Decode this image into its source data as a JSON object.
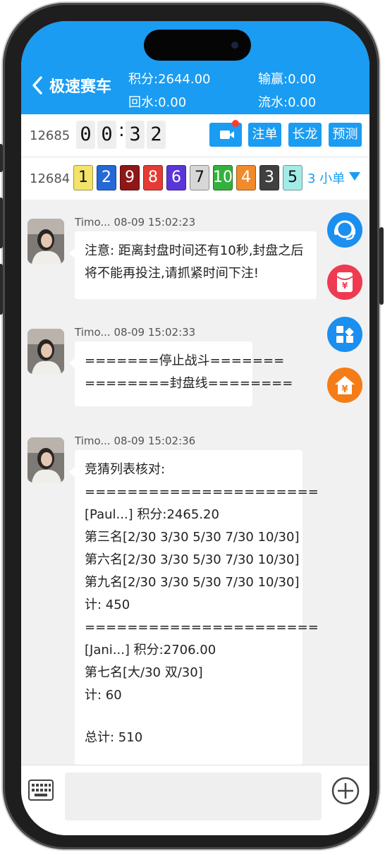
{
  "header": {
    "title": "极速赛车",
    "points": "积分:2644.00",
    "win_loss": "输赢:0.00",
    "rebate": "回水:0.00",
    "turnover": "流水:0.00"
  },
  "current_round": {
    "issue": "12685",
    "countdown_digits": [
      "0",
      "0",
      "3",
      "2"
    ],
    "buttons": {
      "bets": "注单",
      "streak": "长龙",
      "predict": "预测"
    }
  },
  "last_round": {
    "issue": "12684",
    "balls": [
      {
        "n": "1",
        "color": "#f3e36a"
      },
      {
        "n": "2",
        "color": "#2469d6"
      },
      {
        "n": "9",
        "color": "#8e1717"
      },
      {
        "n": "8",
        "color": "#e43b34"
      },
      {
        "n": "6",
        "color": "#5a36d8"
      },
      {
        "n": "7",
        "color": "#d7d7d7"
      },
      {
        "n": "10",
        "color": "#33b03d"
      },
      {
        "n": "4",
        "color": "#f08a2a"
      },
      {
        "n": "3",
        "color": "#404040"
      },
      {
        "n": "5",
        "color": "#a3ebe7"
      }
    ],
    "result": "3 小单"
  },
  "messages": [
    {
      "sender": "Timo...",
      "time": "08-09 15:02:23",
      "lines": [
        "注意: 距离封盘时间还有10秒,封盘之后",
        "将不能再投注,请抓紧时间下注!"
      ]
    },
    {
      "sender": "Timo...",
      "time": "08-09 15:02:33",
      "lines": [
        "=======停止战斗=======",
        "========封盘线========"
      ]
    },
    {
      "sender": "Timo...",
      "time": "08-09 15:02:36",
      "lines": [
        "竞猜列表核对:",
        "======================",
        "[Paul...] 积分:2465.20",
        "第三名[2/30 3/30 5/30 7/30 10/30]",
        "第六名[2/30 3/30 5/30 7/30 10/30]",
        "第九名[2/30 3/30 5/30 7/30 10/30]",
        "计: 450",
        "======================",
        "[Jani...] 积分:2706.00",
        "第七名[大/30 双/30]",
        "计: 60",
        "",
        "总计: 510"
      ]
    }
  ],
  "side_icons": [
    "customer-service-icon",
    "red-packet-icon",
    "apps-icon",
    "home-yuan-icon"
  ],
  "colors": {
    "primary": "#1a9cf2"
  }
}
